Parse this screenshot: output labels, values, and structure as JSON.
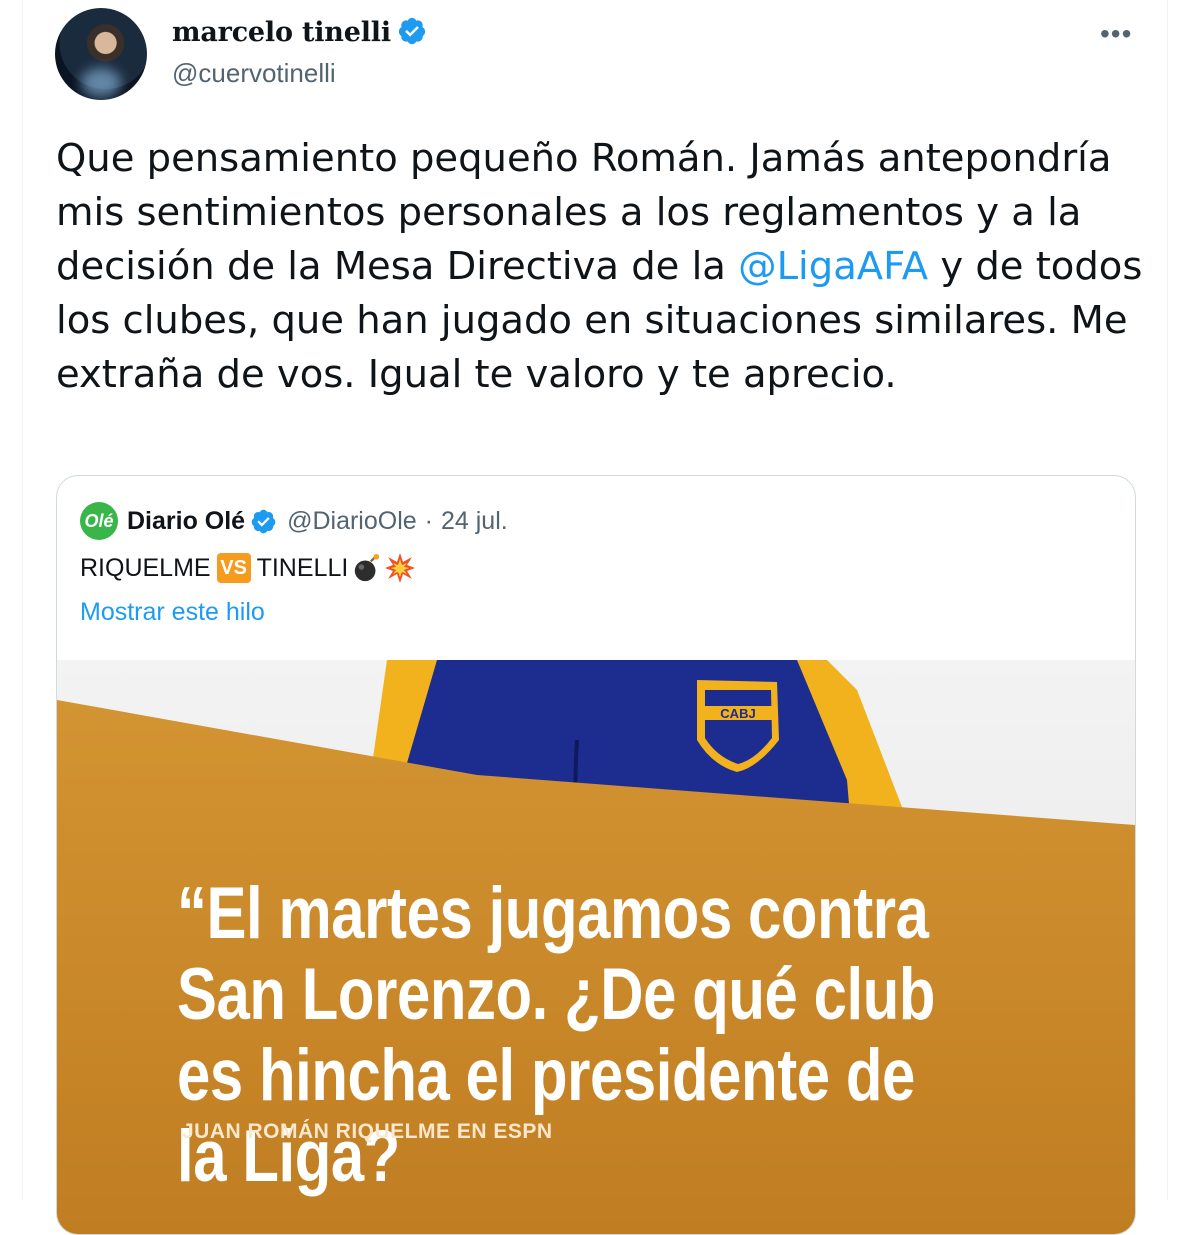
{
  "author": {
    "name": "marcelo tinelli",
    "handle": "@cuervotinelli"
  },
  "menu": {
    "more_label": "•••"
  },
  "tweet": {
    "text_before": "Que pensamiento pequeño Román. Jamás antepondría mis sentimientos personales a los reglamentos y a la decisión de la Mesa Directiva de la ",
    "mention": "@LigaAFA",
    "text_after": " y de todos los clubes, que han jugado en situaciones similares. Me extraña de vos. Igual te valoro y te aprecio."
  },
  "quoted": {
    "logo_text": "Olé",
    "name": "Diario Olé",
    "handle": "@DiarioOle",
    "separator": "·",
    "date": "24 jul.",
    "text_left": "RIQUELME",
    "vs_label": "VS",
    "text_right": "TINELLI",
    "thread_link": "Mostrar este hilo",
    "media": {
      "crest_text": "CABJ",
      "headline": "“El martes jugamos contra San Lorenzo. ¿De qué club es hincha el presidente de la Liga?",
      "attribution": "JUAN ROMÁN RIQUELME EN ESPN"
    }
  },
  "colors": {
    "link": "#1d9bf0",
    "muted": "#536471",
    "verified": "#1d9bf0",
    "media_orange": "#c98a2a",
    "jersey_blue": "#1d2c8f",
    "jersey_yellow": "#f2b21e"
  },
  "icons": [
    "verified-badge-icon",
    "more-options-icon",
    "bomb-emoji-icon",
    "collision-emoji-icon"
  ]
}
